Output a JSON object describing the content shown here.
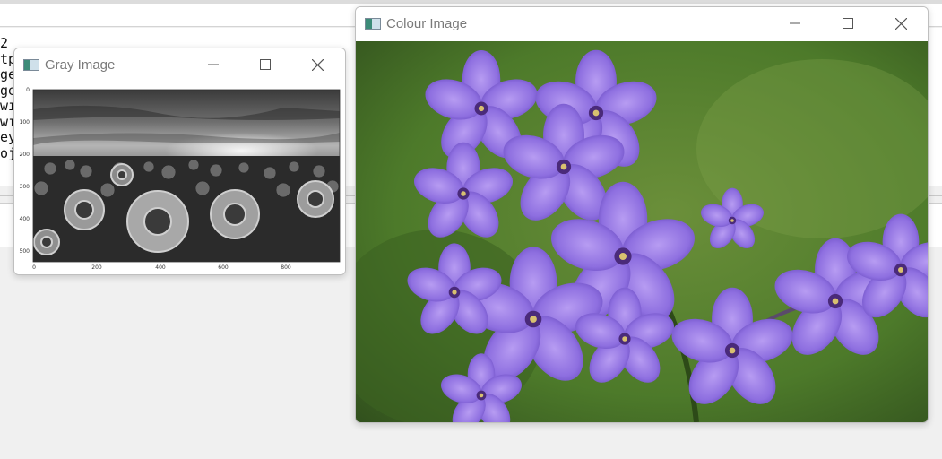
{
  "background_editor": {
    "code_lines": [
      "2",
      "tp",
      "ge",
      "ge",
      "wı",
      "wı",
      "ey",
      "oj"
    ]
  },
  "gray_window": {
    "title": "Gray Image",
    "plot": {
      "x_ticks": [
        "0",
        "200",
        "400",
        "600",
        "800"
      ],
      "y_ticks": [
        "0",
        "100",
        "200",
        "300",
        "400",
        "500"
      ]
    }
  },
  "colour_window": {
    "title": "Colour Image"
  },
  "window_controls": {
    "minimize_icon": "minimize-icon",
    "maximize_icon": "maximize-icon",
    "close_icon": "close-icon"
  },
  "colors": {
    "flower_purple": "#8e6fe0",
    "foliage_green": "#4d7a2a"
  }
}
